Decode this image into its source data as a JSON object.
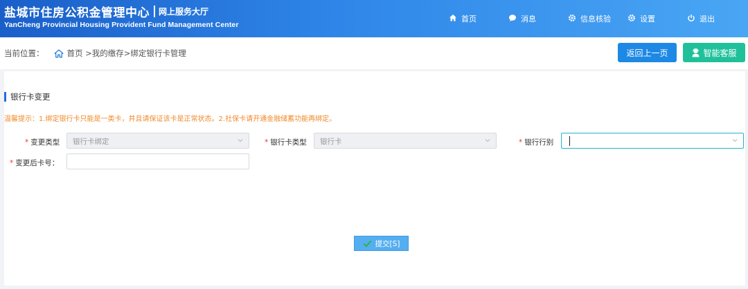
{
  "header": {
    "title_cn": "盐城市住房公积金管理中心",
    "subtitle_cn": "网上服务大厅",
    "title_en": "YanCheng Provincial Housing Provident Fund Management Center",
    "nav": [
      {
        "label": "首页",
        "icon": "home-icon"
      },
      {
        "label": "消息",
        "icon": "message-icon"
      },
      {
        "label": "信息核验",
        "icon": "gear-icon"
      },
      {
        "label": "设置",
        "icon": "gear-icon"
      },
      {
        "label": "退出",
        "icon": "power-icon"
      }
    ]
  },
  "breadcrumb": {
    "prefix": "当前位置：",
    "path": "首页 >我的缴存>绑定银行卡管理"
  },
  "actions": {
    "back_label": "返回上一页",
    "service_label": "智能客服"
  },
  "section": {
    "title": "银行卡变更",
    "tip": "温馨提示：1.绑定银行卡只能是一类卡，并且请保证该卡是正常状态。2.社保卡请开通金融储蓄功能再绑定。"
  },
  "form": {
    "required_mark": "*",
    "change_type": {
      "label": "变更类型",
      "value": "银行卡绑定"
    },
    "card_type": {
      "label": "银行卡类型",
      "value": "银行卡"
    },
    "bank": {
      "label": "银行行别",
      "value": ""
    },
    "new_card_no": {
      "label": "变更后卡号：",
      "value": ""
    },
    "submit_label": "提交[S]"
  },
  "colors": {
    "header_start": "#1a5fc9",
    "header_end": "#49a6f4",
    "primary": "#1e88e5",
    "service": "#20c19a",
    "tip": "#f08a2a",
    "required": "#e33333"
  }
}
